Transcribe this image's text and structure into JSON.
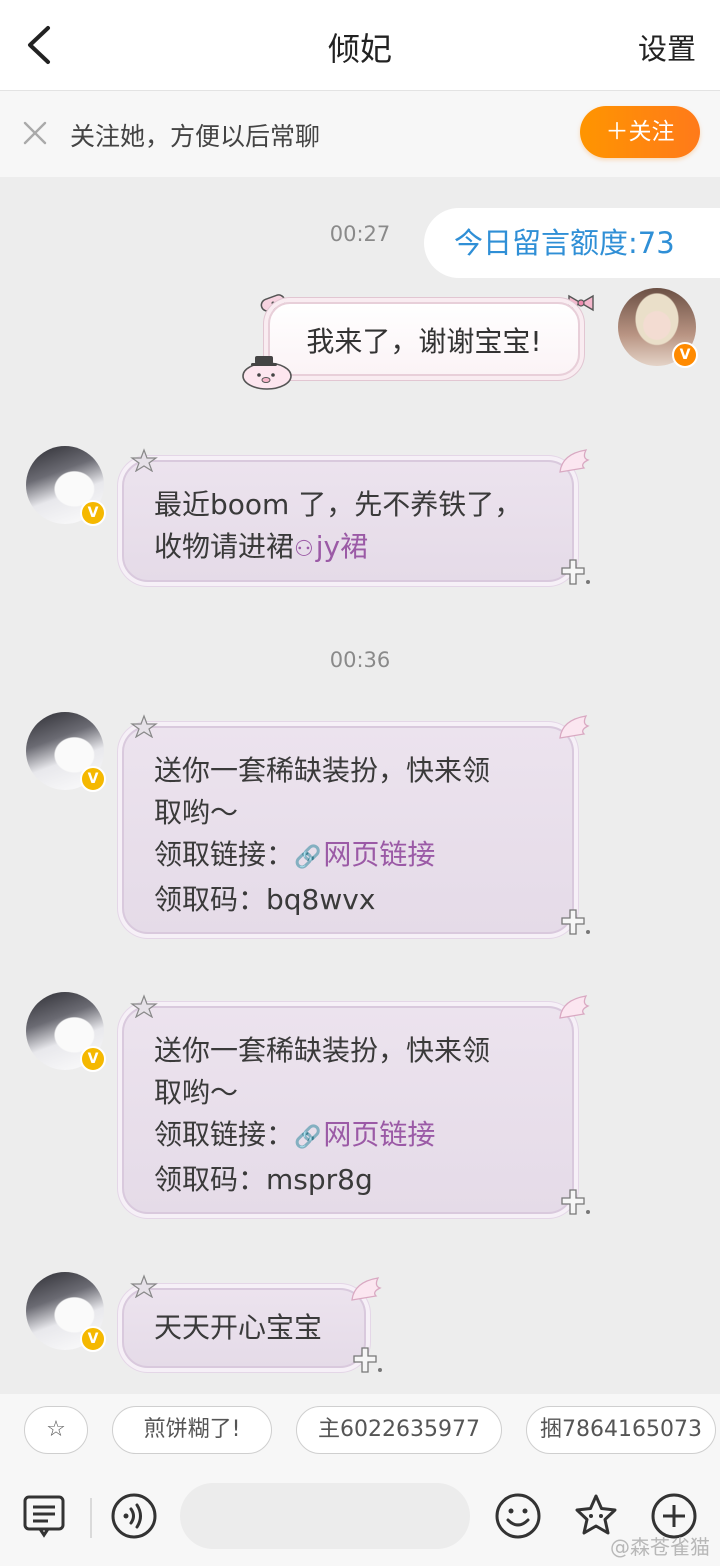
{
  "header": {
    "title": "倾妃",
    "settings_label": "设置"
  },
  "follow_bar": {
    "text": "关注她，方便以后常聊",
    "button_label": "＋关注"
  },
  "chat": {
    "quota_label": "今日留言额度:73",
    "timestamps": [
      "00:27",
      "00:36"
    ],
    "my_message": "我来了，谢谢宝宝!",
    "messages": [
      {
        "lines": [
          [
            "最近boom 了，先不养铁了，"
          ],
          [
            "收物请进裙",
            "jy裙"
          ]
        ]
      },
      {
        "line1": "送你一套稀缺装扮，快来领",
        "line2": "取哟～",
        "link_prefix": "领取链接：",
        "link_text": "网页链接",
        "code_line": "领取码：bq8wvx"
      },
      {
        "line1": "送你一套稀缺装扮，快来领",
        "line2": "取哟～",
        "link_prefix": "领取链接：",
        "link_text": "网页链接",
        "code_line": "领取码：mspr8g"
      },
      {
        "text": "天天开心宝宝"
      }
    ],
    "badge_letter": "V"
  },
  "quick_tags": [
    {
      "label": "☆"
    },
    {
      "label": "煎饼糊了!"
    },
    {
      "label": "主6022635977"
    },
    {
      "label": "捆7864165073"
    }
  ],
  "toolbar": {
    "input_placeholder": "",
    "icons": [
      "keyboard-menu-icon",
      "voice-icon",
      "emoji-icon",
      "sticker-star-icon",
      "plus-icon"
    ]
  },
  "watermark": "@森苍雀猫",
  "colors": {
    "accent_orange": "#ff8a00",
    "quota_blue": "#2f8fd6",
    "link_purple": "#9b5aa6",
    "bubble_bg": "#e8dfea"
  }
}
